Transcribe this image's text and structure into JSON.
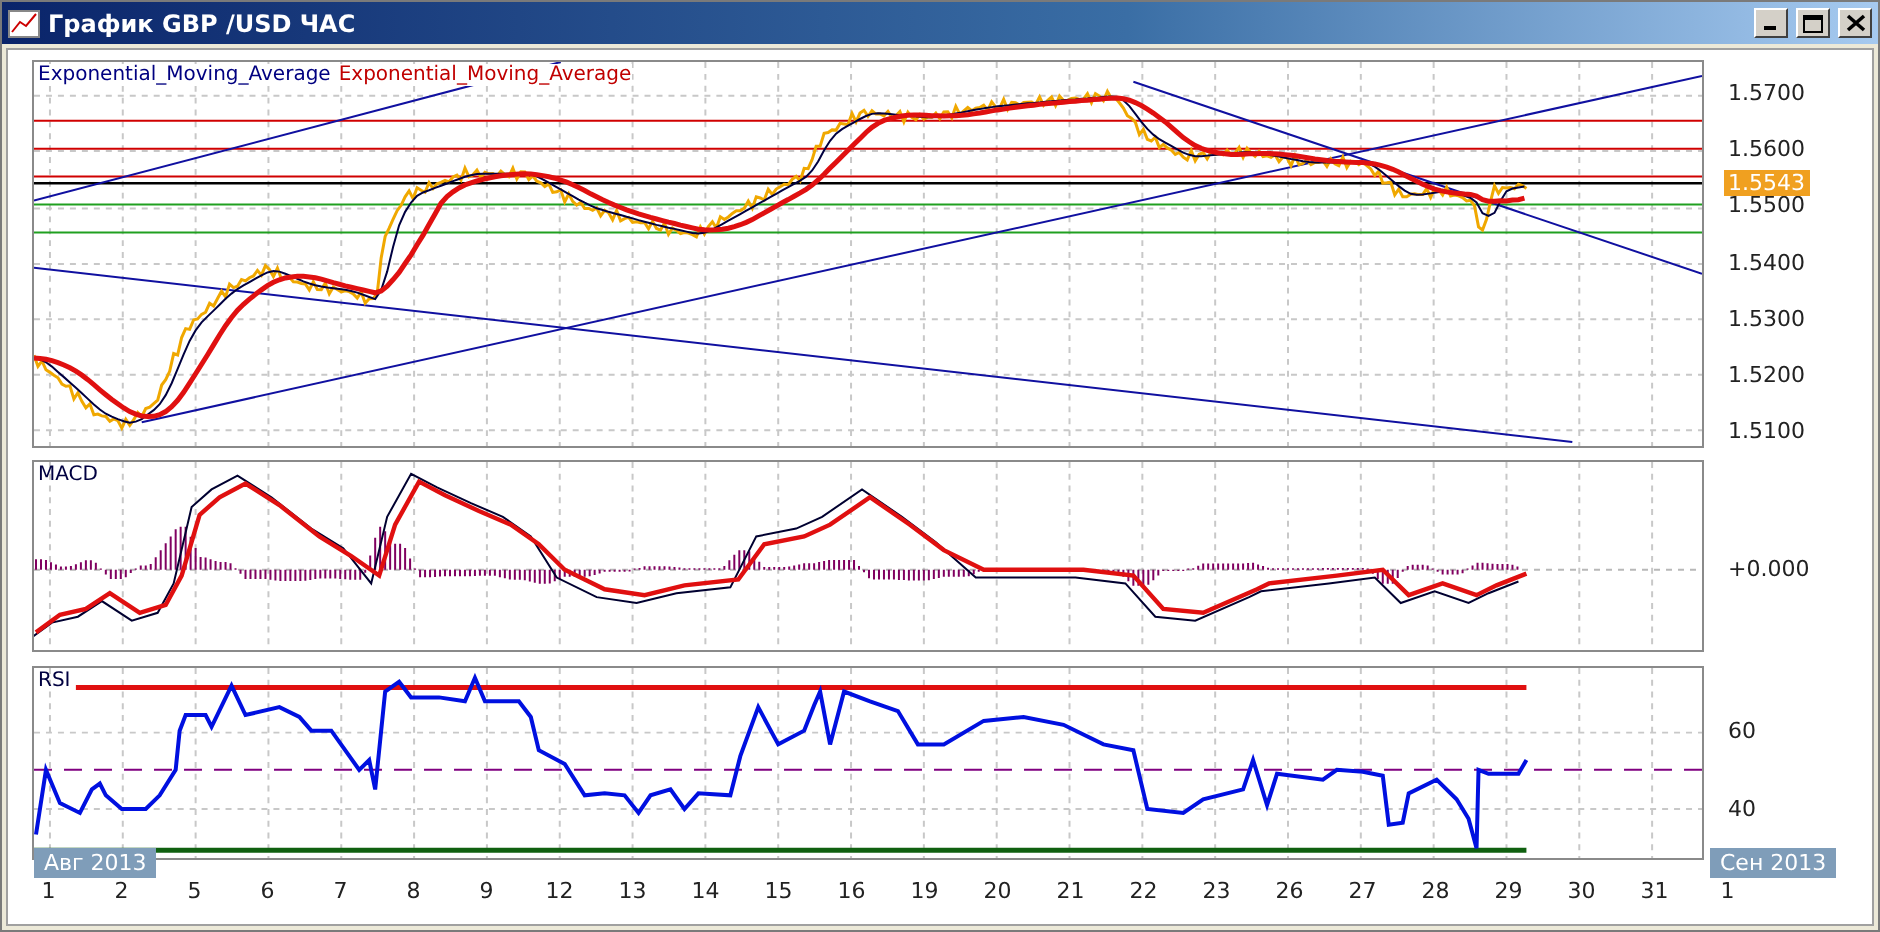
{
  "window": {
    "title": "График GBP /USD  ЧАС"
  },
  "price_panel": {
    "legend": [
      {
        "label": "Exponential_Moving_Average",
        "color": "#000080"
      },
      {
        "label": "Exponential_Moving_Average",
        "color": "#c00000"
      }
    ],
    "y_ticks": [
      "1.5700",
      "1.5600",
      "1.5500",
      "1.5400",
      "1.5300",
      "1.5200",
      "1.5100"
    ],
    "current_price": "1.5543"
  },
  "macd_panel": {
    "label": "MACD",
    "y_ticks": [
      "+0.000"
    ]
  },
  "rsi_panel": {
    "label": "RSI",
    "y_ticks": [
      "60",
      "40"
    ]
  },
  "month_badges": [
    "Авг 2013",
    "Сен 2013"
  ],
  "x_labels": [
    "1",
    "2",
    "5",
    "6",
    "7",
    "8",
    "9",
    "12",
    "13",
    "14",
    "15",
    "16",
    "19",
    "20",
    "21",
    "22",
    "23",
    "26",
    "27",
    "28",
    "29",
    "30",
    "31",
    "1"
  ]
}
